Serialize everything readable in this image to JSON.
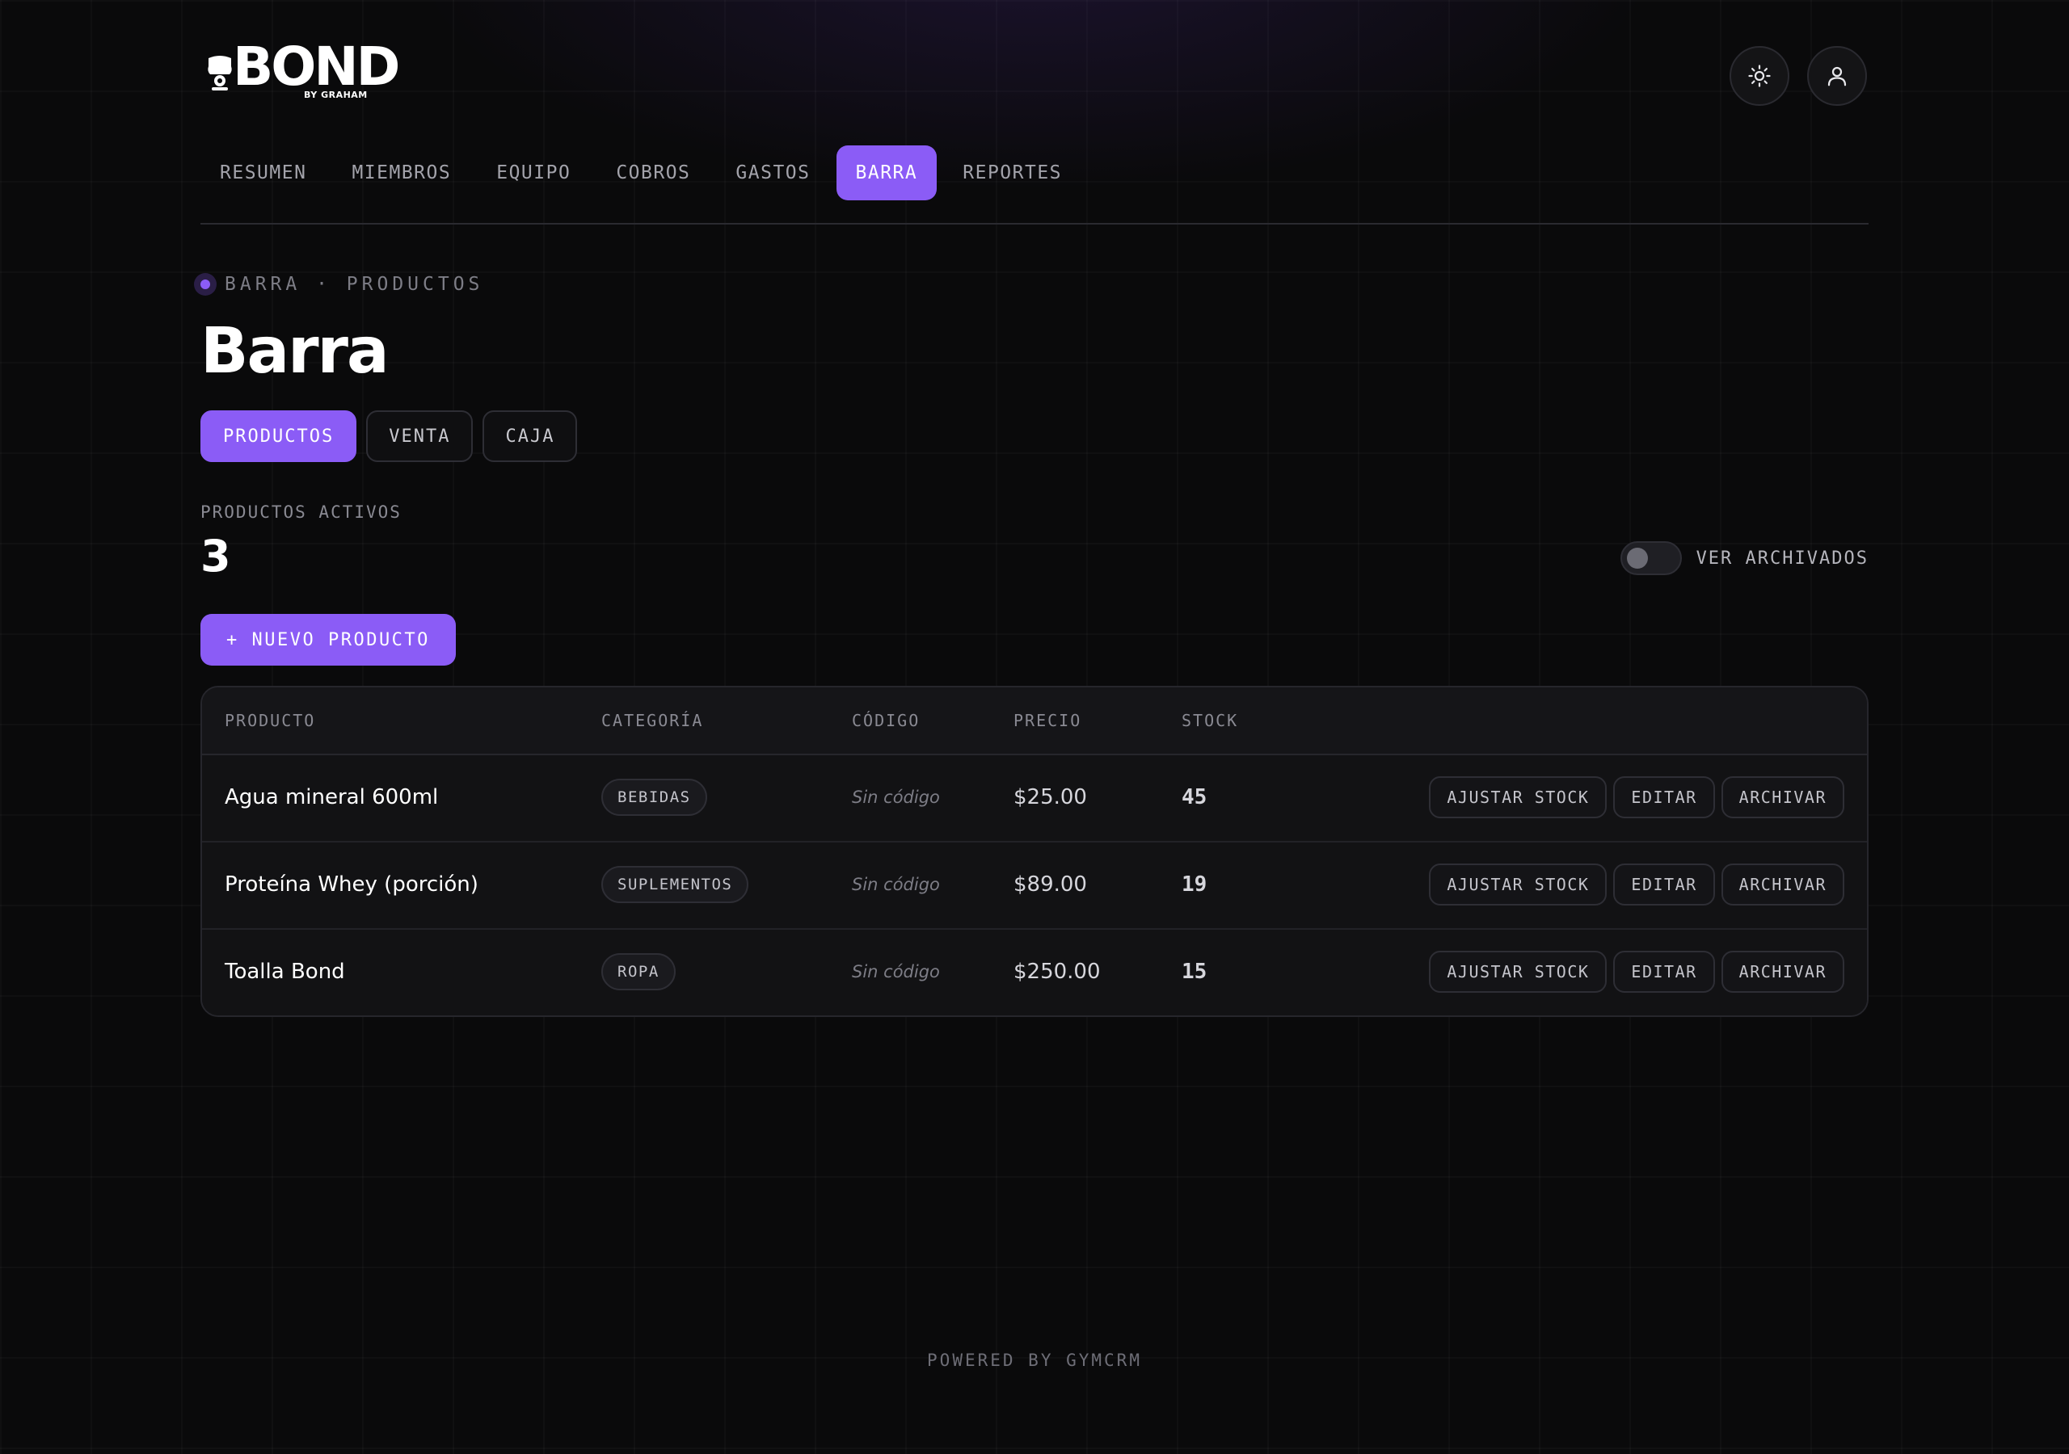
{
  "brand": {
    "name": "BOND",
    "sub": "BY GRAHAM"
  },
  "header": {
    "theme_icon": "sun-icon",
    "profile_icon": "user-icon"
  },
  "nav": {
    "items": [
      {
        "label": "RESUMEN",
        "active": false
      },
      {
        "label": "MIEMBROS",
        "active": false
      },
      {
        "label": "EQUIPO",
        "active": false
      },
      {
        "label": "COBROS",
        "active": false
      },
      {
        "label": "GASTOS",
        "active": false
      },
      {
        "label": "BARRA",
        "active": true
      },
      {
        "label": "REPORTES",
        "active": false
      }
    ]
  },
  "breadcrumb": "BARRA · PRODUCTOS",
  "page_title": "Barra",
  "subtabs": [
    {
      "label": "PRODUCTOS",
      "active": true
    },
    {
      "label": "VENTA",
      "active": false
    },
    {
      "label": "CAJA",
      "active": false
    }
  ],
  "stats": {
    "active_label": "PRODUCTOS ACTIVOS",
    "active_count": "3"
  },
  "archived_toggle": {
    "label": "VER ARCHIVADOS",
    "on": false
  },
  "new_product_button": "+ NUEVO PRODUCTO",
  "table": {
    "headers": {
      "product": "PRODUCTO",
      "category": "CATEGORÍA",
      "code": "CÓDIGO",
      "price": "PRECIO",
      "stock": "STOCK"
    },
    "actions": {
      "adjust": "AJUSTAR STOCK",
      "edit": "EDITAR",
      "archive": "ARCHIVAR"
    },
    "rows": [
      {
        "name": "Agua mineral 600ml",
        "category": "BEBIDAS",
        "code": "Sin código",
        "price": "$25.00",
        "stock": "45"
      },
      {
        "name": "Proteína Whey (porción)",
        "category": "SUPLEMENTOS",
        "code": "Sin código",
        "price": "$89.00",
        "stock": "19"
      },
      {
        "name": "Toalla Bond",
        "category": "ROPA",
        "code": "Sin código",
        "price": "$250.00",
        "stock": "15"
      }
    ]
  },
  "footer": "POWERED BY GYMCRM",
  "colors": {
    "accent": "#8b5cf6",
    "background": "#0a0a0b",
    "surface": "#111113"
  }
}
